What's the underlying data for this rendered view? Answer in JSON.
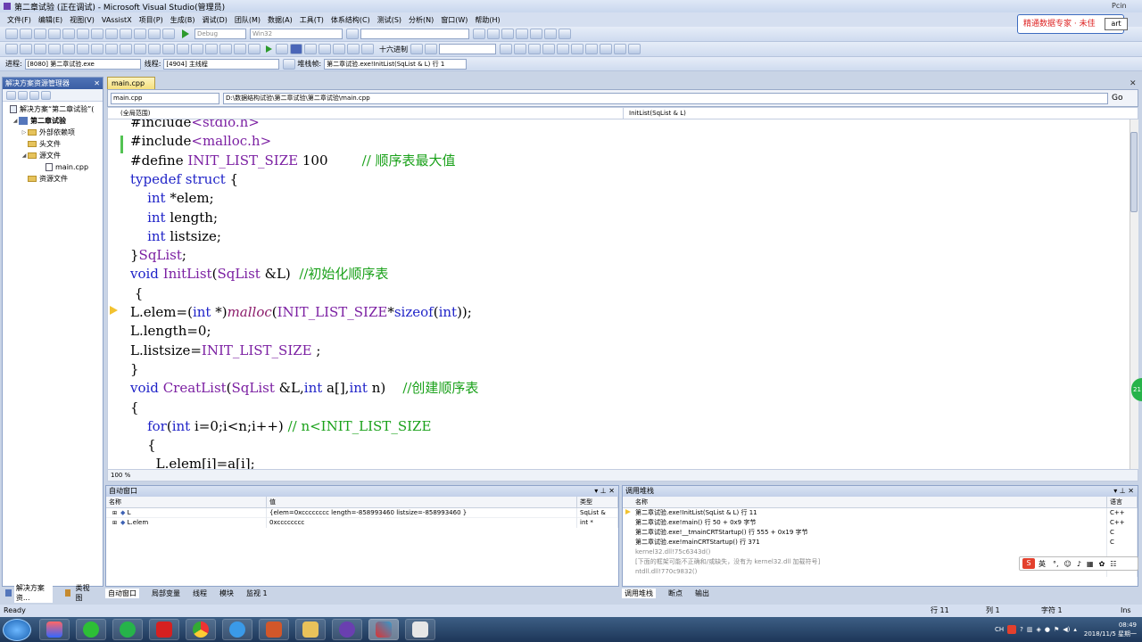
{
  "window": {
    "title": "第二章试验 (正在调试) - Microsoft Visual Studio(管理员)"
  },
  "menu": [
    "文件(F)",
    "编辑(E)",
    "视图(V)",
    "VAssistX",
    "项目(P)",
    "生成(B)",
    "调试(D)",
    "团队(M)",
    "数据(A)",
    "工具(T)",
    "体系结构(C)",
    "测试(S)",
    "分析(N)",
    "窗口(W)",
    "帮助(H)"
  ],
  "toolbar1": {
    "config": "Debug",
    "platform": "Win32"
  },
  "toolbar2": {
    "hex_label": "十六进制"
  },
  "toolbar3": {
    "process_label": "进程:",
    "process": "[8080] 第二章试验.exe",
    "thread_label": "线程:",
    "thread": "[4904] 主线程",
    "stack_label": "堆栈帧:",
    "stack": "第二章试验.exe!InitList(SqList & L) 行 1"
  },
  "overlay": {
    "brand": "精通数据专家 · 未佳",
    "brand_btn": "art",
    "corner": "Pcin"
  },
  "solution_explorer": {
    "title": "解决方案资源管理器",
    "items": [
      {
        "label": "解决方案“第二章试验”(",
        "level": 0
      },
      {
        "label": "第二章试验",
        "level": 1
      },
      {
        "label": "外部依赖项",
        "level": 2
      },
      {
        "label": "头文件",
        "level": 2
      },
      {
        "label": "源文件",
        "level": 2
      },
      {
        "label": "main.cpp",
        "level": 3
      },
      {
        "label": "资源文件",
        "level": 2
      }
    ],
    "tabs": [
      "解决方案资...",
      "类视图"
    ]
  },
  "editor": {
    "tab": "main.cpp",
    "nav_file": "main.cpp",
    "nav_path": "D:\\数据结构试验\\第二章试验\\第二章试验\\main.cpp",
    "nav_go": "Go",
    "scope": "(全局范围)",
    "member": "InitList(SqList & L)",
    "zoom": "100 %",
    "bubble": "21"
  },
  "code_lines": [
    [
      [
        "#include",
        ""
      ],
      [
        "<stdio.h>",
        "mac"
      ]
    ],
    [
      [
        "#include",
        ""
      ],
      [
        "<malloc.h>",
        "mac"
      ]
    ],
    [
      [
        "#define ",
        ""
      ],
      [
        "INIT_LIST_SIZE",
        "mac"
      ],
      [
        " 100        ",
        ""
      ],
      [
        "// 顺序表最大值",
        "cm"
      ]
    ],
    [
      [
        "typedef struct",
        "kw"
      ],
      [
        " {",
        ""
      ]
    ],
    [
      [
        "    int",
        "kw"
      ],
      [
        " *elem;",
        ""
      ]
    ],
    [
      [
        "    int",
        "kw"
      ],
      [
        " length;",
        ""
      ]
    ],
    [
      [
        "    int",
        "kw"
      ],
      [
        " listsize;",
        ""
      ]
    ],
    [
      [
        "}",
        ""
      ],
      [
        "SqList",
        "mac"
      ],
      [
        ";",
        ""
      ]
    ],
    [
      [
        "void",
        "kw"
      ],
      [
        " ",
        ""
      ],
      [
        "InitList",
        "mac"
      ],
      [
        "(",
        ""
      ],
      [
        "SqList",
        "mac"
      ],
      [
        " &L)  ",
        ""
      ],
      [
        "//初始化顺序表",
        "cm"
      ]
    ],
    [
      [
        " {",
        ""
      ]
    ],
    [
      [
        "L.elem=(",
        ""
      ],
      [
        "int",
        "kw"
      ],
      [
        " *)",
        ""
      ],
      [
        "malloc",
        "fn"
      ],
      [
        "(",
        ""
      ],
      [
        "INIT_LIST_SIZE",
        "mac"
      ],
      [
        "*",
        ""
      ],
      [
        "sizeof",
        "kw"
      ],
      [
        "(",
        ""
      ],
      [
        "int",
        "kw"
      ],
      [
        "));",
        ""
      ]
    ],
    [
      [
        "L.length=0;",
        ""
      ]
    ],
    [
      [
        "L.listsize=",
        ""
      ],
      [
        "INIT_LIST_SIZE",
        "mac"
      ],
      [
        " ;",
        ""
      ]
    ],
    [
      [
        "}",
        ""
      ]
    ],
    [
      [
        "void",
        "kw"
      ],
      [
        " ",
        ""
      ],
      [
        "CreatList",
        "mac"
      ],
      [
        "(",
        ""
      ],
      [
        "SqList",
        "mac"
      ],
      [
        " &L,",
        ""
      ],
      [
        "int",
        "kw"
      ],
      [
        " a[],",
        ""
      ],
      [
        "int",
        "kw"
      ],
      [
        " n)    ",
        ""
      ],
      [
        "//创建顺序表",
        "cm"
      ]
    ],
    [
      [
        "{",
        ""
      ]
    ],
    [
      [
        "    for",
        "kw"
      ],
      [
        "(",
        ""
      ],
      [
        "int",
        "kw"
      ],
      [
        " i=0;i<n;i++) ",
        ""
      ],
      [
        "// n<INIT_LIST_SIZE",
        "cm"
      ]
    ],
    [
      [
        "    {",
        ""
      ]
    ],
    [
      [
        "      L.elem[i]=a[i];",
        ""
      ]
    ]
  ],
  "autos": {
    "title": "自动窗口",
    "columns": [
      "名称",
      "值",
      "类型"
    ],
    "rows": [
      {
        "name": "L",
        "value": "{elem=0xcccccccc length=-858993460 listsize=-858993460 }",
        "type": "SqList &"
      },
      {
        "name": "L.elem",
        "value": "0xcccccccc",
        "type": "int *"
      }
    ],
    "tabs": [
      "自动窗口",
      "局部变量",
      "线程",
      "模块",
      "监视 1"
    ]
  },
  "callstack": {
    "title": "调用堆栈",
    "columns": [
      "名称",
      "语言"
    ],
    "rows": [
      {
        "name": "第二章试验.exe!InitList(SqList & L)  行 11",
        "lang": "C++",
        "gray": false
      },
      {
        "name": "第二章试验.exe!main()  行 50 + 0x9 字节",
        "lang": "C++",
        "gray": false
      },
      {
        "name": "第二章试验.exe!__tmainCRTStartup()  行 555 + 0x19 字节",
        "lang": "C",
        "gray": false
      },
      {
        "name": "第二章试验.exe!mainCRTStartup()  行 371",
        "lang": "C",
        "gray": false
      },
      {
        "name": "kernel32.dll!75c6343d()",
        "lang": "",
        "gray": true
      },
      {
        "name": "[下面的框架可能不正确和/或缺失，没有为 kernel32.dll 加载符号]",
        "lang": "",
        "gray": true
      },
      {
        "name": "ntdll.dll!770c9832()",
        "lang": "",
        "gray": true
      }
    ],
    "tabs": [
      "调用堆栈",
      "断点",
      "输出"
    ]
  },
  "ime": {
    "label": "英"
  },
  "status": {
    "ready": "Ready",
    "line": "行 11",
    "col": "列 1",
    "char": "字符 1",
    "mode": "Ins"
  },
  "tray": {
    "lang": "CH",
    "time": "08:49",
    "date": "2018/11/5 星期一"
  }
}
